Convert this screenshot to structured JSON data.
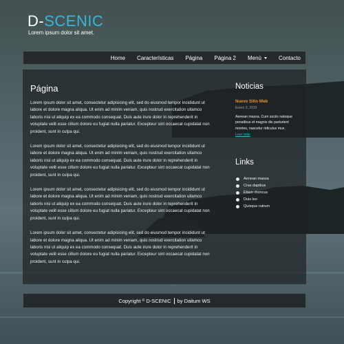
{
  "header": {
    "logo_part1": "D-",
    "logo_part2": "SCENIC",
    "tagline": "Lorem ipsum dolor sit amet."
  },
  "nav": {
    "items": [
      {
        "label": "Home"
      },
      {
        "label": "Características"
      },
      {
        "label": "Página"
      },
      {
        "label": "Página 2"
      },
      {
        "label": "Menú",
        "has_dropdown": true
      },
      {
        "label": "Contacto"
      }
    ]
  },
  "main": {
    "title": "Página",
    "paragraphs": [
      "Lorem ipsum dolor sit amet, consectetur adipisicing elit, sed do eiusmod tempor incididunt ut labore et dolore magna aliqua. Ut enim ad minim veniam, quis nostrud exercitation ullamco laboris nisi ut aliquip ex ea commodo consequat. Duis aute irure dolor in reprehenderit in voluptate velit esse cillum dolore eu fugiat nulla pariatur. Excepteur sint occaecat cupidatat non proident, sunt in culpa qui.",
      "Lorem ipsum dolor sit amet, consectetur adipisicing elit, sed do eiusmod tempor incididunt ut labore et dolore magna aliqua. Ut enim ad minim veniam, quis nostrud exercitation ullamco laboris nisi ut aliquip ex ea commodo consequat. Duis aute irure dolor in reprehenderit in voluptate velit esse cillum dolore eu fugiat nulla pariatur. Excepteur sint occaecat cupidatat non proident, sunt in culpa qui.",
      "Lorem ipsum dolor sit amet, consectetur adipisicing elit, sed do eiusmod tempor incididunt ut labore et dolore magna aliqua. Ut enim ad minim veniam, quis nostrud exercitation ullamco laboris nisi ut aliquip ex ea commodo consequat. Duis aute irure dolor in reprehenderit in voluptate velit esse cillum dolore eu fugiat nulla pariatur. Excepteur sint occaecat cupidatat non proident, sunt in culpa qui.",
      "Lorem ipsum dolor sit amet, consectetur adipisicing elit, sed do eiusmod tempor incididunt ut labore et dolore magna aliqua. Ut enim ad minim veniam, quis nostrud exercitation ullamco laboris nisi ut aliquip ex ea commodo consequat. Duis aute irure dolor in reprehenderit in voluptate velit esse cillum dolore eu fugiat nulla pariatur. Excepteur sint occaecat cupidatat non proident, sunt in culpa qui."
    ]
  },
  "sidebar": {
    "news_title": "Noticias",
    "news_headline": "Nuevo Sitio Web",
    "news_date": "Enero 3, 2015",
    "news_body": "Aenean massa. Cum sociis natoque penatibus et magnis dis parturient montes, nascetur ridiculus mus.",
    "news_more": "Leer más",
    "links_title": "Links",
    "links": [
      "Aenean massa",
      "Cras dapibus",
      "Etiam rhoncus",
      "Duis leo",
      "Quisque rutrum"
    ]
  },
  "footer": {
    "copyright_prefix": "Copyright",
    "copyright_symbol": "©",
    "brand": "D-SCENIC",
    "credit": "by Daitum WS"
  },
  "colors": {
    "accent_cyan": "#38b6d8",
    "news_orange": "#f0902a",
    "sky": "#5a6a70",
    "sea": "#4d6066"
  }
}
